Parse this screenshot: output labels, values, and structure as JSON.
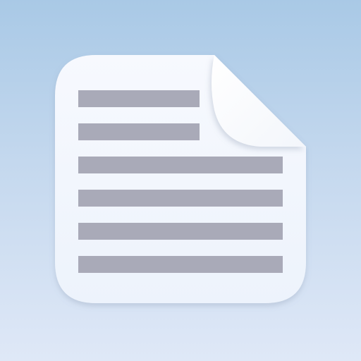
{
  "app_icon": {
    "icon": "document-icon",
    "text_line_count": 6,
    "colors": {
      "background_top": "#a9c9e6",
      "background_bottom": "#dfe8f7",
      "paper": "#f2f6fd",
      "fold": "#ffffff",
      "text_line": "#a9aab8"
    }
  }
}
